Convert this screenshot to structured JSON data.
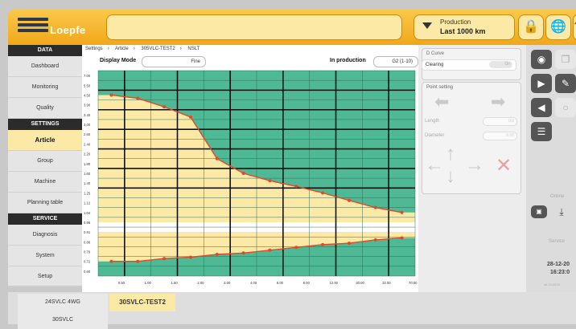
{
  "app": {
    "logo_text": "Loepfe"
  },
  "header": {
    "search_value": "",
    "filter_title": "Production",
    "filter_value": "Last 1000 km"
  },
  "sidebar": {
    "sections": [
      {
        "title": "DATA",
        "items": [
          "Dashboard",
          "Monitoring",
          "Quality"
        ]
      },
      {
        "title": "SETTINGS",
        "items": [
          "Article",
          "Group",
          "Machine",
          "Planning table"
        ]
      },
      {
        "title": "SERVICE",
        "items": [
          "Diagnosis",
          "System",
          "Setup"
        ]
      }
    ],
    "active": "Article"
  },
  "breadcrumb": [
    "Settings",
    "Article",
    "305VLC-TEST2",
    "NSLT"
  ],
  "controls": {
    "display_mode_label": "Display Mode",
    "display_mode_value": "Fine",
    "in_production_label": "In production",
    "in_production_value": "G2 (1-10)"
  },
  "chart_data": {
    "type": "heatmap",
    "description_note": "",
    "y_ticks": [
      "7.00",
      "5.50",
      "4.50",
      "3.90",
      "3.40",
      "3.00",
      "2.60",
      "2.40",
      "2.20",
      "1.80",
      "1.60",
      "1.40",
      "1.25",
      "1.12",
      "1.04",
      "0.96",
      "0.91",
      "0.86",
      "0.79",
      "0.72",
      "0.60"
    ],
    "x_ticks": [
      "0.50",
      "1.00",
      "1.50",
      "2.00",
      "3.00",
      "4.00",
      "6.00",
      "8.00",
      "12.00",
      "20.00",
      "32.00",
      "70.00"
    ],
    "upper_curve_y": [
      4.5,
      4.3,
      3.8,
      3.3,
      2.0,
      1.6,
      1.45,
      1.35,
      1.25,
      1.15,
      1.08,
      1.04
    ],
    "lower_curve_y": [
      0.72,
      0.72,
      0.74,
      0.75,
      0.77,
      0.78,
      0.8,
      0.82,
      0.84,
      0.85,
      0.87,
      0.88
    ],
    "colors": {
      "green": "#4fb894",
      "yellow": "#fde9a6",
      "curve": "#e04a2a"
    }
  },
  "panel": {
    "dcurve_title": "D Curve",
    "clearing_label": "Clearing",
    "clearing_toggle": "On",
    "point_setting_title": "Point setting",
    "length_label": "Length",
    "length_value": "0.0",
    "diameter_label": "Diameter",
    "diameter_value": "0.00"
  },
  "side": {
    "online_label": "Online",
    "service_label": "Service",
    "date": "28-12-20",
    "time": "16:23:0",
    "version": "v6.23.4019"
  },
  "bottom_tabs": [
    "24SVLC 4WG",
    "30SVLC-TEST2",
    "30SVLC"
  ]
}
